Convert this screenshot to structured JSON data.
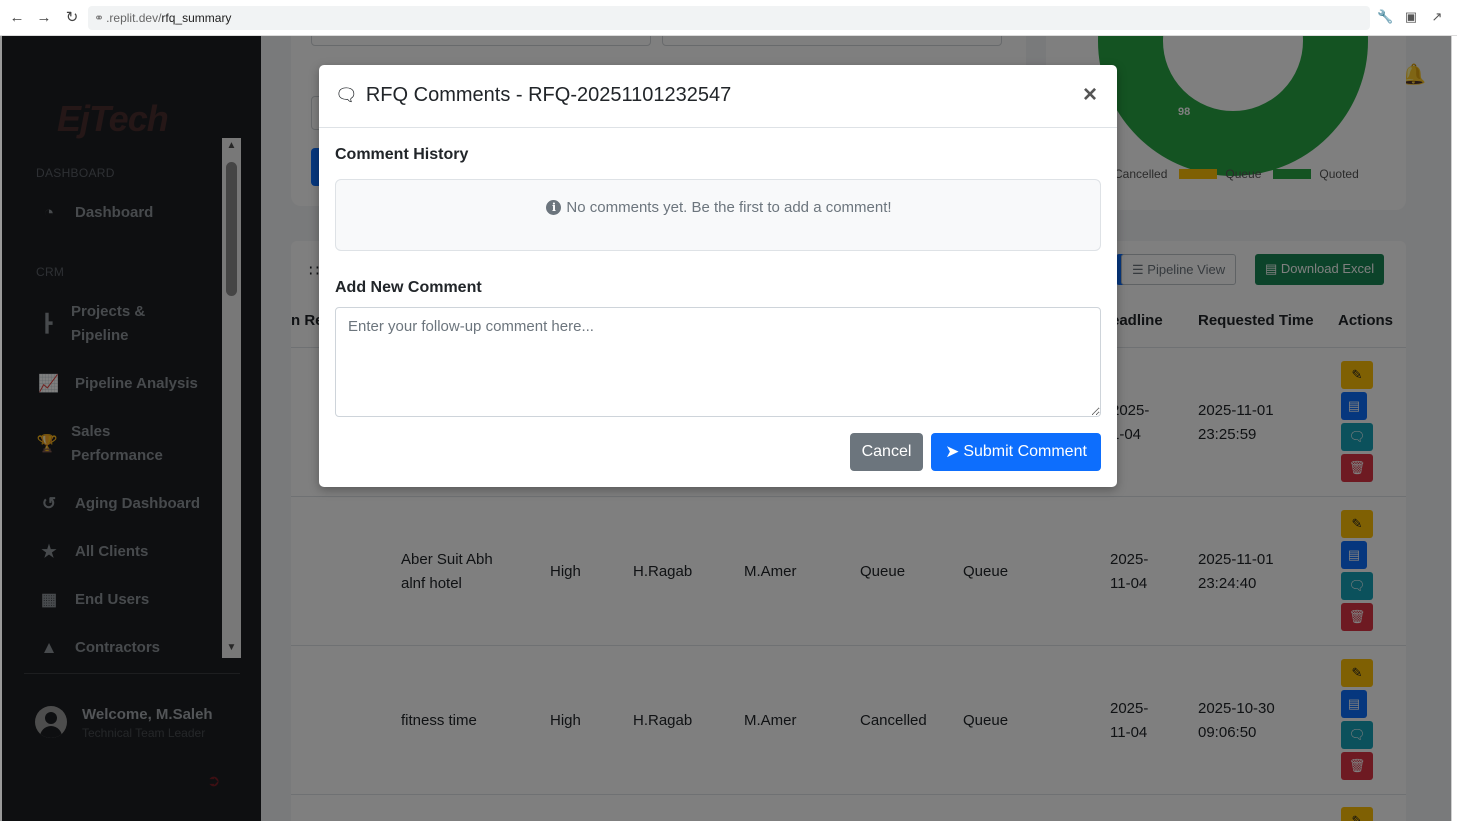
{
  "browser": {
    "url_prefix": ".replit.dev/",
    "url_path": "rfq_summary"
  },
  "sidebar": {
    "logo": "EjTech",
    "sections": [
      {
        "label": "DASHBOARD"
      },
      {
        "label": "CRM"
      }
    ],
    "items": [
      {
        "label": "Dashboard",
        "icon": "gauge-icon"
      },
      {
        "label": "Projects & Pipeline",
        "icon": "sitemap-icon"
      },
      {
        "label": "Pipeline Analysis",
        "icon": "chart-line-icon"
      },
      {
        "label": "Sales Performance",
        "icon": "trophy-icon"
      },
      {
        "label": "Aging Dashboard",
        "icon": "history-icon"
      },
      {
        "label": "All Clients",
        "icon": "star-icon"
      },
      {
        "label": "End Users",
        "icon": "building-icon"
      },
      {
        "label": "Contractors",
        "icon": "hard-hat-icon"
      }
    ],
    "user": {
      "welcome": "Welcome, M.Saleh",
      "role": "Technical Team Leader"
    }
  },
  "background": {
    "chart_data": {
      "type": "pie",
      "slices": [
        {
          "label": "Quoted",
          "value": 98
        }
      ],
      "legend": [
        "Cancelled",
        "Queue",
        "Quoted"
      ],
      "colors": {
        "Cancelled": "#0d6efd",
        "Queue": "#ffc107",
        "Quoted": "#28a745"
      }
    },
    "buttons": {
      "pipeline_view": "Pipeline View",
      "download_excel": "Download Excel"
    },
    "table": {
      "headers": {
        "partial_left": "n Re",
        "deadline": "eadline",
        "requested_time": "Requested Time",
        "actions": "Actions"
      },
      "rows": [
        {
          "project": "",
          "priority": "",
          "sales": "",
          "assigned": "",
          "status1": "",
          "status2": "",
          "deadline": "2025-\n1-04",
          "requested": "2025-11-01\n23:25:59"
        },
        {
          "project": "Aber Suit Abh\nalnf hotel",
          "priority": "High",
          "sales": "H.Ragab",
          "assigned": "M.Amer",
          "status1": "Queue",
          "status2": "Queue",
          "deadline": "2025-\n11-04",
          "requested": "2025-11-01\n23:24:40"
        },
        {
          "project": "fitness time",
          "priority": "High",
          "sales": "H.Ragab",
          "assigned": "M.Amer",
          "status1": "Cancelled",
          "status2": "Queue",
          "deadline": "2025-\n11-04",
          "requested": "2025-10-30\n09:06:50"
        }
      ]
    }
  },
  "modal": {
    "title": "RFQ Comments - RFQ-20251101232547",
    "history_title": "Comment History",
    "empty_message": "No comments yet. Be the first to add a comment!",
    "new_comment_title": "Add New Comment",
    "comment_placeholder": "Enter your follow-up comment here...",
    "comment_value": "",
    "cancel_label": "Cancel",
    "submit_label": "Submit Comment"
  }
}
